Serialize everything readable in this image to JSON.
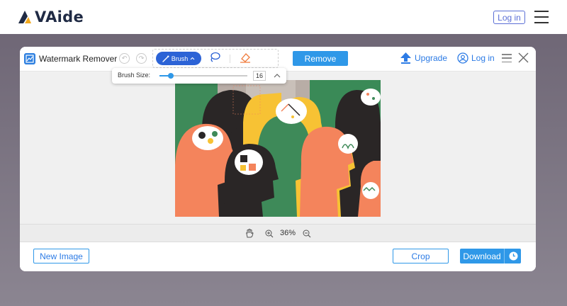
{
  "site": {
    "brand": "VAide",
    "login_label": "Log in"
  },
  "modal": {
    "title": "Watermark Remover",
    "brush_label": "Brush",
    "remove_label": "Remove",
    "upgrade_label": "Upgrade",
    "login_label": "Log in",
    "zoom_text": "36%",
    "new_image_label": "New Image",
    "crop_label": "Crop",
    "download_label": "Download"
  },
  "brush_popover": {
    "label": "Brush Size:",
    "value": "16",
    "slider_fraction": 0.13
  },
  "colors": {
    "accent": "#2f98e8",
    "brush_active": "#2c63d6",
    "link": "#2c7be5",
    "brand_dark": "#1f2a44",
    "eraser": "#f07a3a"
  },
  "icons": {
    "app": "image-edit-icon",
    "undo": "undo-icon",
    "redo": "redo-icon",
    "brush": "brush-icon",
    "lasso": "lasso-icon",
    "eraser": "eraser-icon",
    "upgrade": "upload-arrow-icon",
    "user": "user-icon",
    "menu": "hamburger-icon",
    "close": "close-icon",
    "hand": "hand-icon",
    "zoom_in": "zoom-in-icon",
    "zoom_out": "zoom-out-icon",
    "clock": "clock-icon"
  }
}
